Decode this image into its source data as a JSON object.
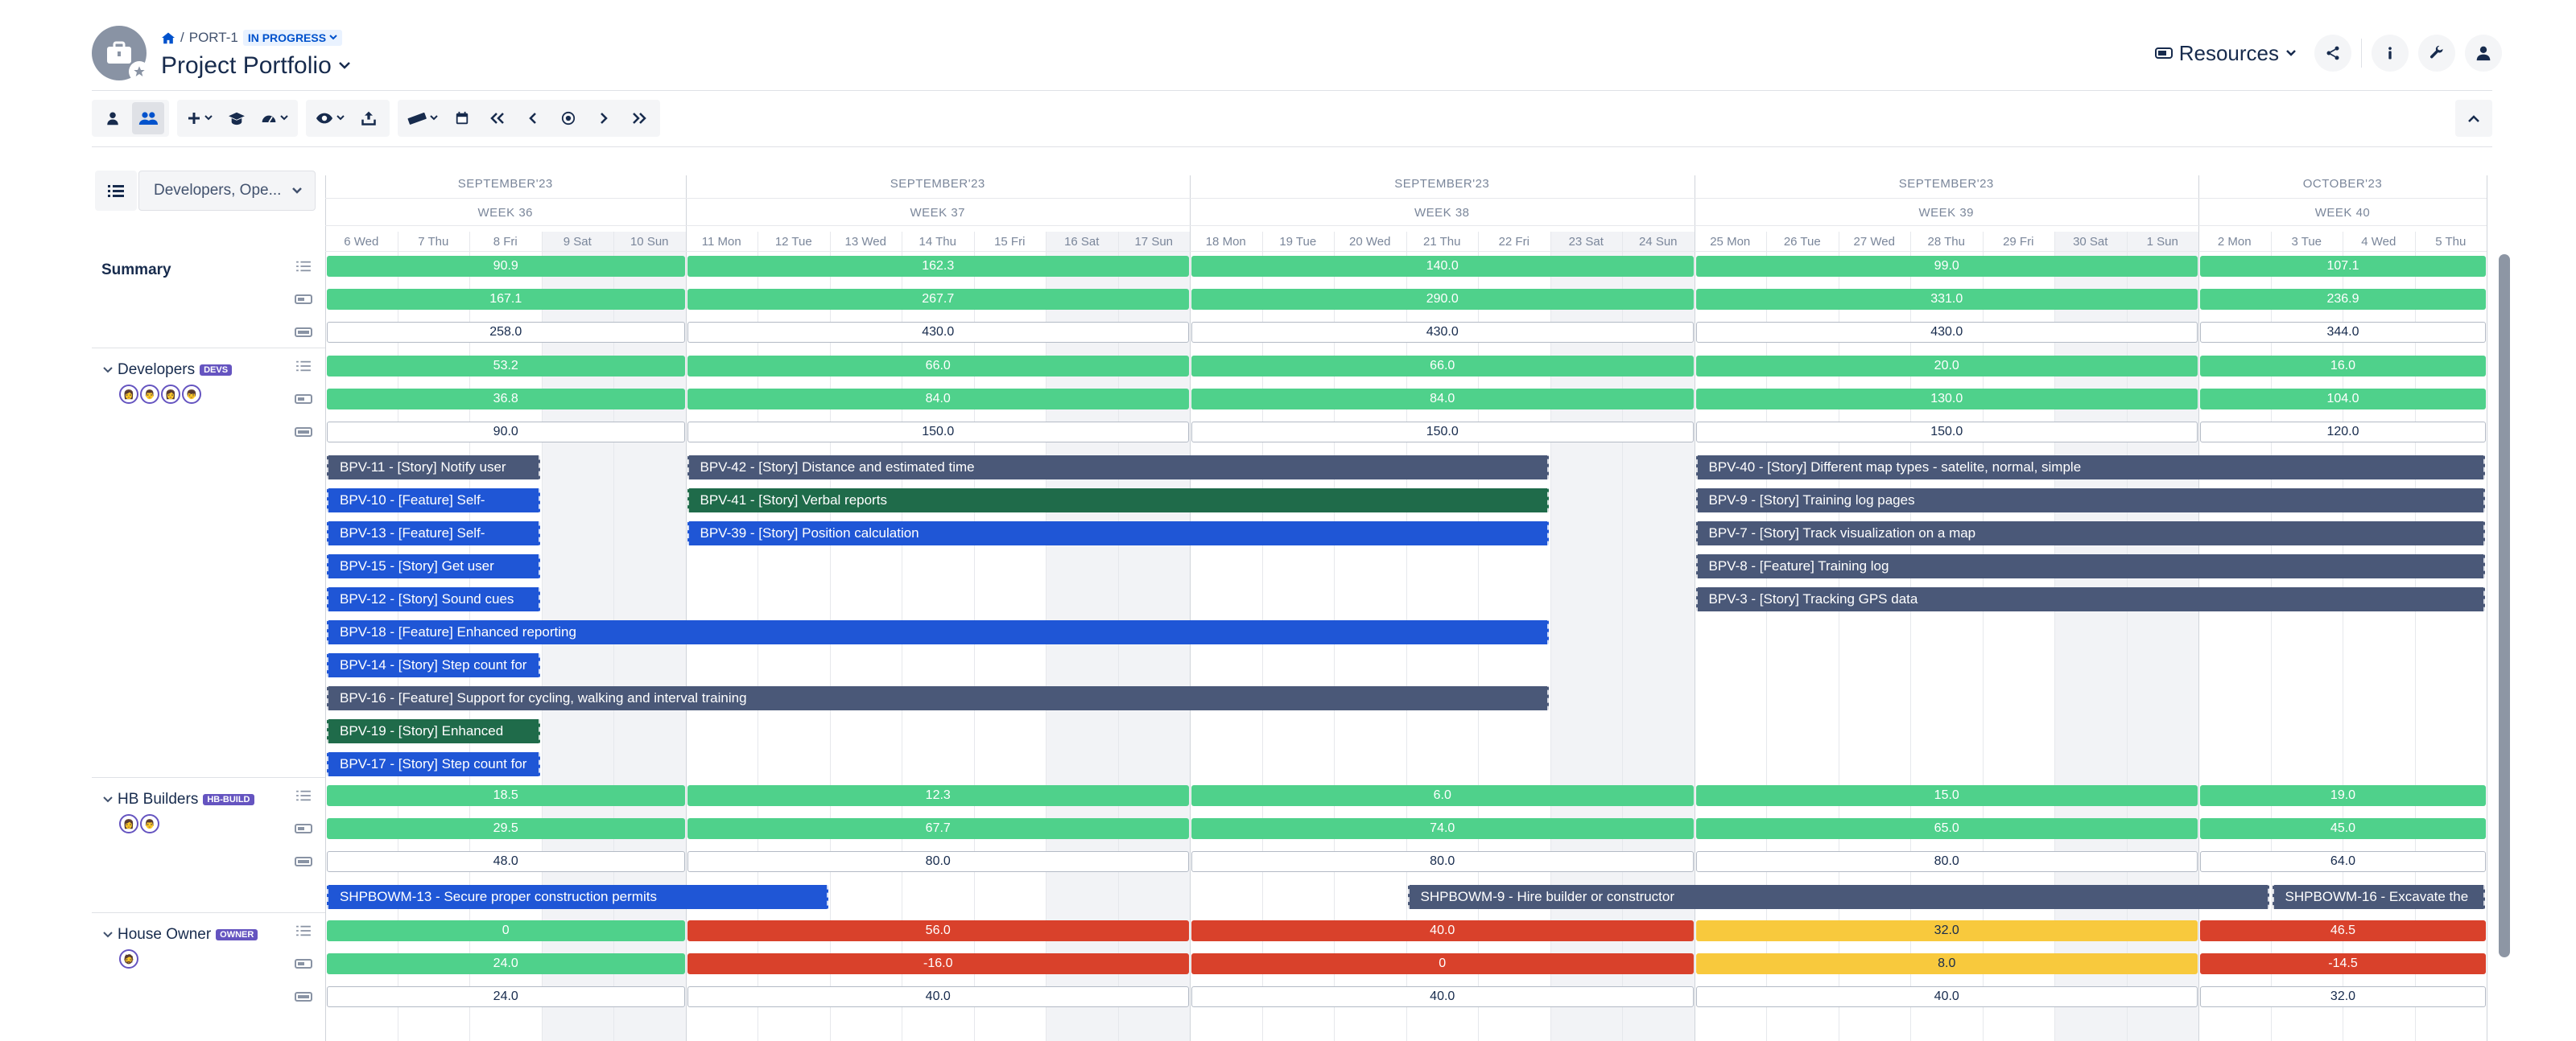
{
  "header": {
    "breadcrumb_id": "PORT-1",
    "breadcrumb_sep": "/",
    "status": "IN PROGRESS",
    "title": "Project Portfolio",
    "resources_label": "Resources"
  },
  "filter": {
    "selected": "Developers, Ope..."
  },
  "timeline": {
    "months": [
      {
        "label": "SEPTEMBER'23",
        "week": "WEEK 36",
        "days": [
          "6 Wed",
          "7 Thu",
          "8 Fri",
          "9 Sat",
          "10 Sun"
        ]
      },
      {
        "label": "SEPTEMBER'23",
        "week": "WEEK 37",
        "days": [
          "11 Mon",
          "12 Tue",
          "13 Wed",
          "14 Thu",
          "15 Fri",
          "16 Sat",
          "17 Sun"
        ]
      },
      {
        "label": "SEPTEMBER'23",
        "week": "WEEK 38",
        "days": [
          "18 Mon",
          "19 Tue",
          "20 Wed",
          "21 Thu",
          "22 Fri",
          "23 Sat",
          "24 Sun"
        ]
      },
      {
        "label": "SEPTEMBER'23",
        "week": "WEEK 39",
        "days": [
          "25 Mon",
          "26 Tue",
          "27 Wed",
          "28 Thu",
          "29 Fri",
          "30 Sat",
          "1 Sun"
        ]
      },
      {
        "label": "OCTOBER'23",
        "week": "WEEK 40",
        "days": [
          "2 Mon",
          "3 Tue",
          "4 Wed",
          "5 Thu"
        ]
      }
    ]
  },
  "groups": [
    {
      "name": "Summary",
      "tag": "",
      "bold": true,
      "avatars": [],
      "metrics": [
        {
          "style": "green",
          "values": [
            "90.9",
            "162.3",
            "140.0",
            "99.0",
            "107.1"
          ]
        },
        {
          "style": "green",
          "values": [
            "167.1",
            "267.7",
            "290.0",
            "331.0",
            "236.9"
          ]
        },
        {
          "style": "outline",
          "values": [
            "258.0",
            "430.0",
            "430.0",
            "430.0",
            "344.0"
          ]
        }
      ],
      "tasks": []
    },
    {
      "name": "Developers",
      "tag": "DEVS",
      "bold": false,
      "avatars": [
        "👩",
        "👨",
        "👩",
        "👦"
      ],
      "metrics": [
        {
          "style": "green",
          "values": [
            "53.2",
            "66.0",
            "66.0",
            "20.0",
            "16.0"
          ]
        },
        {
          "style": "green",
          "values": [
            "36.8",
            "84.0",
            "84.0",
            "130.0",
            "104.0"
          ]
        },
        {
          "style": "outline",
          "values": [
            "90.0",
            "150.0",
            "150.0",
            "150.0",
            "120.0"
          ]
        }
      ],
      "tasks": [
        {
          "label": "BPV-11 - [Story] Notify user",
          "color": "slate",
          "start": 0,
          "end": 3,
          "row": 0
        },
        {
          "label": "BPV-42 - [Story] Distance and estimated time",
          "color": "slate",
          "start": 5,
          "end": 17,
          "row": 0
        },
        {
          "label": "BPV-40 - [Story] Different map types - satelite, normal, simple",
          "color": "slate",
          "start": 19,
          "end": 30,
          "row": 0
        },
        {
          "label": "BPV-10 - [Feature] Self-",
          "color": "blue",
          "start": 0,
          "end": 3,
          "row": 1
        },
        {
          "label": "BPV-41 - [Story] Verbal reports",
          "color": "green",
          "start": 5,
          "end": 17,
          "row": 1
        },
        {
          "label": "BPV-9 - [Story] Training log pages",
          "color": "slate",
          "start": 19,
          "end": 30,
          "row": 1
        },
        {
          "label": "BPV-13 - [Feature] Self-",
          "color": "blue",
          "start": 0,
          "end": 3,
          "row": 2
        },
        {
          "label": "BPV-39 - [Story] Position calculation",
          "color": "blue",
          "start": 5,
          "end": 17,
          "row": 2
        },
        {
          "label": "BPV-7 - [Story] Track visualization on a map",
          "color": "slate",
          "start": 19,
          "end": 30,
          "row": 2
        },
        {
          "label": "BPV-15 - [Story] Get user",
          "color": "blue",
          "start": 0,
          "end": 3,
          "row": 3
        },
        {
          "label": "BPV-8 - [Feature] Training log",
          "color": "slate",
          "start": 19,
          "end": 30,
          "row": 3
        },
        {
          "label": "BPV-12 - [Story] Sound cues",
          "color": "blue",
          "start": 0,
          "end": 3,
          "row": 4
        },
        {
          "label": "BPV-3 - [Story] Tracking GPS data",
          "color": "slate",
          "start": 19,
          "end": 30,
          "row": 4
        },
        {
          "label": "BPV-18 - [Feature] Enhanced reporting",
          "color": "blue",
          "start": 0,
          "end": 17,
          "row": 5
        },
        {
          "label": "BPV-14 - [Story] Step count for",
          "color": "blue",
          "start": 0,
          "end": 3,
          "row": 6
        },
        {
          "label": "BPV-16 - [Feature] Support for cycling, walking and interval training",
          "color": "slate",
          "start": 0,
          "end": 17,
          "row": 7
        },
        {
          "label": "BPV-19 - [Story] Enhanced",
          "color": "green",
          "start": 0,
          "end": 3,
          "row": 8
        },
        {
          "label": "BPV-17 - [Story] Step count for",
          "color": "blue",
          "start": 0,
          "end": 3,
          "row": 9
        }
      ]
    },
    {
      "name": "HB Builders",
      "tag": "HB-BUILD",
      "bold": false,
      "avatars": [
        "👩",
        "👨"
      ],
      "metrics": [
        {
          "style": "green",
          "values": [
            "18.5",
            "12.3",
            "6.0",
            "15.0",
            "19.0"
          ]
        },
        {
          "style": "green",
          "values": [
            "29.5",
            "67.7",
            "74.0",
            "65.0",
            "45.0"
          ]
        },
        {
          "style": "outline",
          "values": [
            "48.0",
            "80.0",
            "80.0",
            "80.0",
            "64.0"
          ]
        }
      ],
      "tasks": [
        {
          "label": "SHPBOWM-13 - Secure proper construction permits",
          "color": "blue",
          "start": 0,
          "end": 7,
          "row": 0
        },
        {
          "label": "SHPBOWM-9 - Hire builder or constructor",
          "color": "slate",
          "start": 15,
          "end": 27,
          "row": 0
        },
        {
          "label": "SHPBOWM-16 - Excavate the",
          "color": "slate",
          "start": 27,
          "end": 30,
          "row": 0
        }
      ]
    },
    {
      "name": "House Owner",
      "tag": "OWNER",
      "bold": false,
      "avatars": [
        "🧔"
      ],
      "metrics": [
        {
          "style": "mixed",
          "styles": [
            "green",
            "red",
            "red",
            "yellow",
            "red"
          ],
          "values": [
            "0",
            "56.0",
            "40.0",
            "32.0",
            "46.5"
          ]
        },
        {
          "style": "mixed",
          "styles": [
            "green",
            "red",
            "red",
            "yellow",
            "red"
          ],
          "values": [
            "24.0",
            "-16.0",
            "0",
            "8.0",
            "-14.5"
          ]
        },
        {
          "style": "outline",
          "values": [
            "24.0",
            "40.0",
            "40.0",
            "40.0",
            "32.0"
          ]
        }
      ],
      "tasks": []
    }
  ]
}
